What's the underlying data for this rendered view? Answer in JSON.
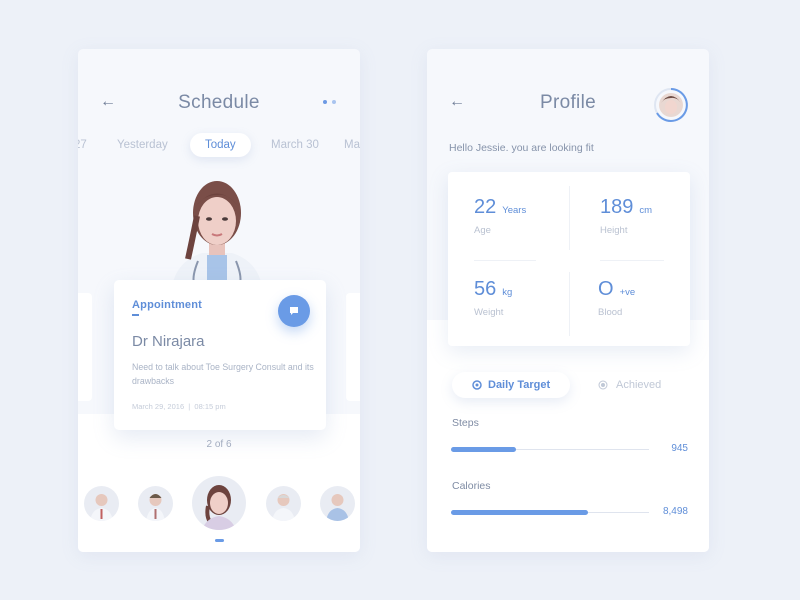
{
  "schedule": {
    "title": "Schedule",
    "back_icon": "arrow-left-icon",
    "menu_icon": "more-dots-icon",
    "dates": [
      "27",
      "Yesterday",
      "Today",
      "March 30",
      "Ma"
    ],
    "active_date": "Today",
    "appointment": {
      "label": "Appointment",
      "doctor": "Dr Nirajara",
      "description": "Need to talk about Toe Surgery Consult and its drawbacks",
      "date": "March 29, 2016",
      "separator": "|",
      "time": "08:15 pm",
      "action_icon": "chat-bubble-icon"
    },
    "pager": "2 of 6",
    "doctors": [
      "doctor-1",
      "doctor-2",
      "doctor-3",
      "doctor-4",
      "doctor-5"
    ],
    "selected_doctor_index": 2
  },
  "profile": {
    "title": "Profile",
    "back_icon": "arrow-left-icon",
    "avatar": "user-avatar",
    "greeting": "Hello Jessie. you are looking fit",
    "stats": [
      {
        "value": "22",
        "unit": "Years",
        "label": "Age"
      },
      {
        "value": "189",
        "unit": "cm",
        "label": "Height"
      },
      {
        "value": "56",
        "unit": "kg",
        "label": "Weight"
      },
      {
        "value": "O",
        "unit": "+ve",
        "label": "Blood"
      }
    ],
    "tabs": {
      "active": "Daily Target",
      "inactive": "Achieved"
    },
    "metrics": [
      {
        "label": "Steps",
        "value": "945",
        "progress": 0.33
      },
      {
        "label": "Calories",
        "value": "8,498",
        "progress": 0.69
      }
    ]
  }
}
